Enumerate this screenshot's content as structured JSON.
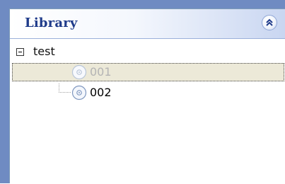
{
  "panel": {
    "title": "Library"
  },
  "tree": {
    "root": {
      "label": "test",
      "expanded": true
    },
    "children": [
      {
        "label": "001",
        "selected": true,
        "icon": "disc-icon"
      },
      {
        "label": "002",
        "selected": false,
        "icon": "disc-icon"
      }
    ]
  },
  "colors": {
    "frame": "#6f8bc2",
    "title": "#1f3b8a",
    "selection_bg": "#ece9d8",
    "disabled_text": "#b4b4b4"
  }
}
